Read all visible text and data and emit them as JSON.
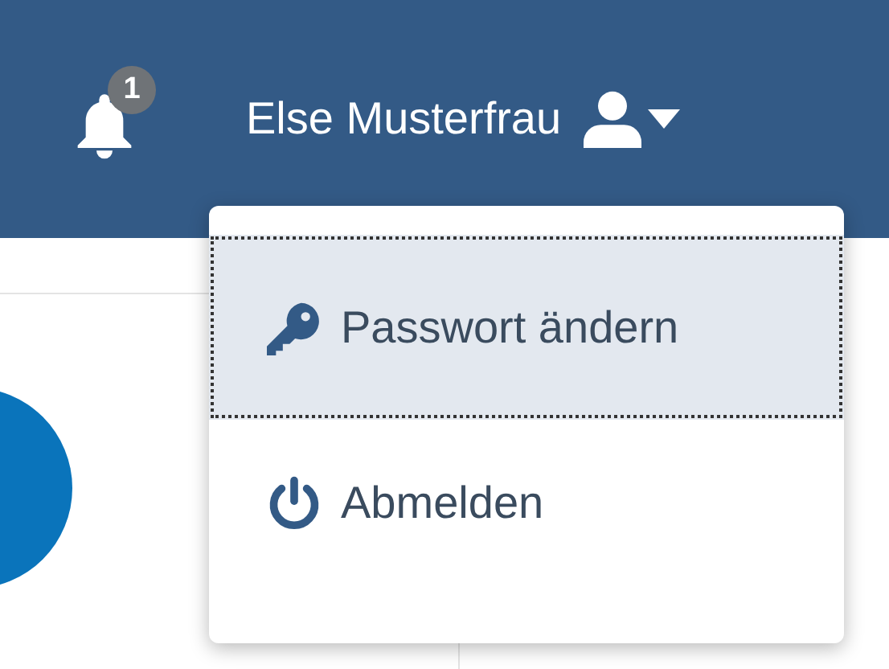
{
  "header": {
    "notifications": {
      "count": "1"
    },
    "user": {
      "name": "Else Musterfrau",
      "menu_open": true
    }
  },
  "user_menu": [
    {
      "kind": "key",
      "label": "Passwort ändern",
      "selected": true
    },
    {
      "kind": "power",
      "label": "Abmelden",
      "selected": false
    }
  ]
}
